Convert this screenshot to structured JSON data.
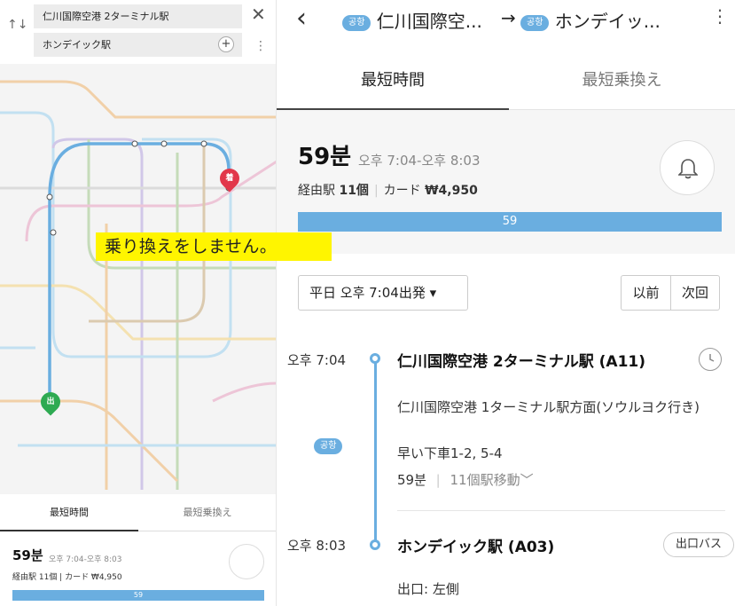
{
  "left_panel": {
    "from_station": "仁川国際空港 2ターミナル駅",
    "to_station": "ホンデイック駅",
    "swap_icon": "↑↓",
    "close_icon": "✕",
    "add_icon": "+",
    "more_icon": "⋮",
    "pin_dest_label": "着",
    "pin_start_label": "出",
    "tabs": [
      "最短時間",
      "最短乗換え"
    ],
    "summary": {
      "duration": "59분",
      "time_range": "오후 7:04-오후 8:03",
      "meta": "経由駅 11個  |  カード ₩4,950",
      "bar_label": "59"
    }
  },
  "annotation": "乗り換えをしません。",
  "header": {
    "back_icon": "‹",
    "from_badge": "공항",
    "from_title": "仁川国際空...",
    "arrow": "→",
    "to_badge": "공항",
    "to_title": "ホンデイッ...",
    "more_icon": "⋮"
  },
  "tabs": {
    "shortest": "最短時間",
    "fewest_transfers": "最短乗換え"
  },
  "summary": {
    "duration": "59분",
    "time_range": "오후 7:04-오후 8:03",
    "stops_label": "経由駅",
    "stops_value": "11個",
    "fare_label": "カード",
    "fare_value": "₩4,950",
    "bar_label": "59"
  },
  "departure": {
    "select_label": "平日 오후 7:04出発 ▾",
    "prev_label": "以前",
    "next_label": "次回"
  },
  "route": {
    "start_time": "오후 7:04",
    "start_station": "仁川国際空港 2ターミナル駅 (A11)",
    "line_badge": "공항",
    "direction": "仁川国際空港 1ターミナル駅方面(ソウルヨク行き)",
    "quick_exit": "早い下車1-2, 5-4",
    "ride_duration": "59분",
    "ride_moves": "11個駅移動",
    "end_time": "오후 8:03",
    "end_station": "ホンデイック駅 (A03)",
    "exit_bus_label": "出口バス",
    "exit_info": "出口: 左側"
  },
  "colors": {
    "accent": "#6aaee0",
    "dest_pin": "#e2374a",
    "start_pin": "#2eaa52",
    "highlight": "#fff500"
  }
}
